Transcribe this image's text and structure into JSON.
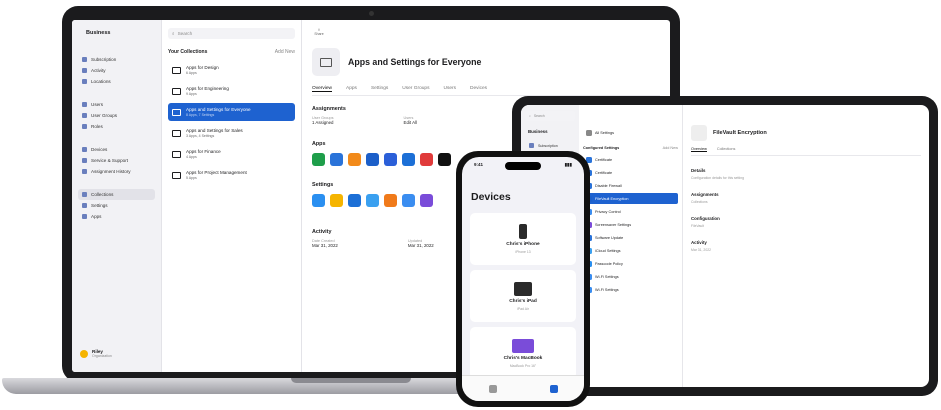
{
  "laptop": {
    "brand": "Business",
    "sidebar": {
      "groups": [
        [
          "Subscription",
          "Activity",
          "Locations"
        ],
        [
          "Users",
          "User Groups",
          "Roles"
        ],
        [
          "Devices",
          "Service & Support",
          "Assignment History"
        ],
        [
          "Collections",
          "Settings",
          "Apps"
        ]
      ],
      "active": "Collections",
      "user_name": "Riley",
      "user_sub": "Organization"
    },
    "list": {
      "search_placeholder": "Search",
      "heading": "Your Collections",
      "heading_right": "Add New",
      "items": [
        {
          "title": "Apps for Design",
          "sub": "6 Apps"
        },
        {
          "title": "Apps for Engineering",
          "sub": "9 Apps"
        },
        {
          "title": "Apps and Settings for Everyone",
          "sub": "8 Apps, 7 Settings"
        },
        {
          "title": "Apps and Settings for Sales",
          "sub": "3 Apps, 4 Settings"
        },
        {
          "title": "Apps for Finance",
          "sub": "4 Apps"
        },
        {
          "title": "Apps for Project Management",
          "sub": "5 Apps"
        }
      ],
      "selected_index": 2
    },
    "detail": {
      "action_label": "Share",
      "title": "Apps and Settings for Everyone",
      "tabs": [
        "Overview",
        "Apps",
        "Settings",
        "User Groups",
        "Users",
        "Devices"
      ],
      "active_tab": "Overview",
      "assignments_heading": "Assignments",
      "assign_kv": [
        {
          "k": "User Groups",
          "v": "1 Assigned"
        },
        {
          "k": "Users",
          "v": "Edit All"
        }
      ],
      "apps_heading": "Apps",
      "app_colors": [
        "#1e9e4a",
        "#2a73d9",
        "#f28a1a",
        "#1c5fc9",
        "#2b5fd8",
        "#1c6fd6",
        "#e03a3a",
        "#111111"
      ],
      "settings_heading": "Settings",
      "setting_colors": [
        "#2a8ff0",
        "#f5b400",
        "#1c6fd6",
        "#3aa0f0",
        "#f07a1a",
        "#3a8df0",
        "#7a4cd9"
      ],
      "activity_heading": "Activity",
      "activity_kv": [
        {
          "k": "Date Created",
          "v": "Mar 31, 2022"
        },
        {
          "k": "Updated",
          "v": "Mar 31, 2022"
        }
      ]
    }
  },
  "ipad": {
    "brand": "Business",
    "search_placeholder": "Search",
    "sidebar_items": [
      "Subscription",
      "Activity",
      "Locations"
    ],
    "list_top": "All Settings",
    "list_heading": "Configured Settings",
    "list_heading_right": "Add New",
    "list_items": [
      "Certificate",
      "Certificate",
      "Disable Firewall",
      "FileVault Encryption",
      "Privacy Control",
      "Screensaver Settings",
      "Software Update",
      "iCloud Settings",
      "Passcode Policy",
      "Wi-Fi Settings",
      "Wi-Fi Settings"
    ],
    "list_colors": [
      "#2a73d9",
      "#2a73d9",
      "#2a73d9",
      "#1c5fc9",
      "#3a8df0",
      "#7a4cd9",
      "#2a73d9",
      "#3aa0f0",
      "#2a8ff0",
      "#3a8df0",
      "#3a8df0"
    ],
    "selected_index": 3,
    "detail_title": "FileVault Encryption",
    "detail_tabs": [
      "Overview",
      "Collections"
    ],
    "sections": [
      {
        "h": "Details",
        "t": "Configuration details for this setting"
      },
      {
        "h": "Assignments",
        "t": "Collections"
      },
      {
        "h": "Configuration",
        "t": "FileVault"
      },
      {
        "h": "Activity",
        "t": "Mar 31, 2022"
      }
    ]
  },
  "iphone": {
    "time": "9:41",
    "title": "Devices",
    "devices": [
      {
        "name": "Chris's iPhone",
        "sub": "iPhone 13"
      },
      {
        "name": "Chris's iPad",
        "sub": "iPad Air"
      },
      {
        "name": "Chris's MacBook",
        "sub": "MacBook Pro 16\""
      }
    ]
  }
}
